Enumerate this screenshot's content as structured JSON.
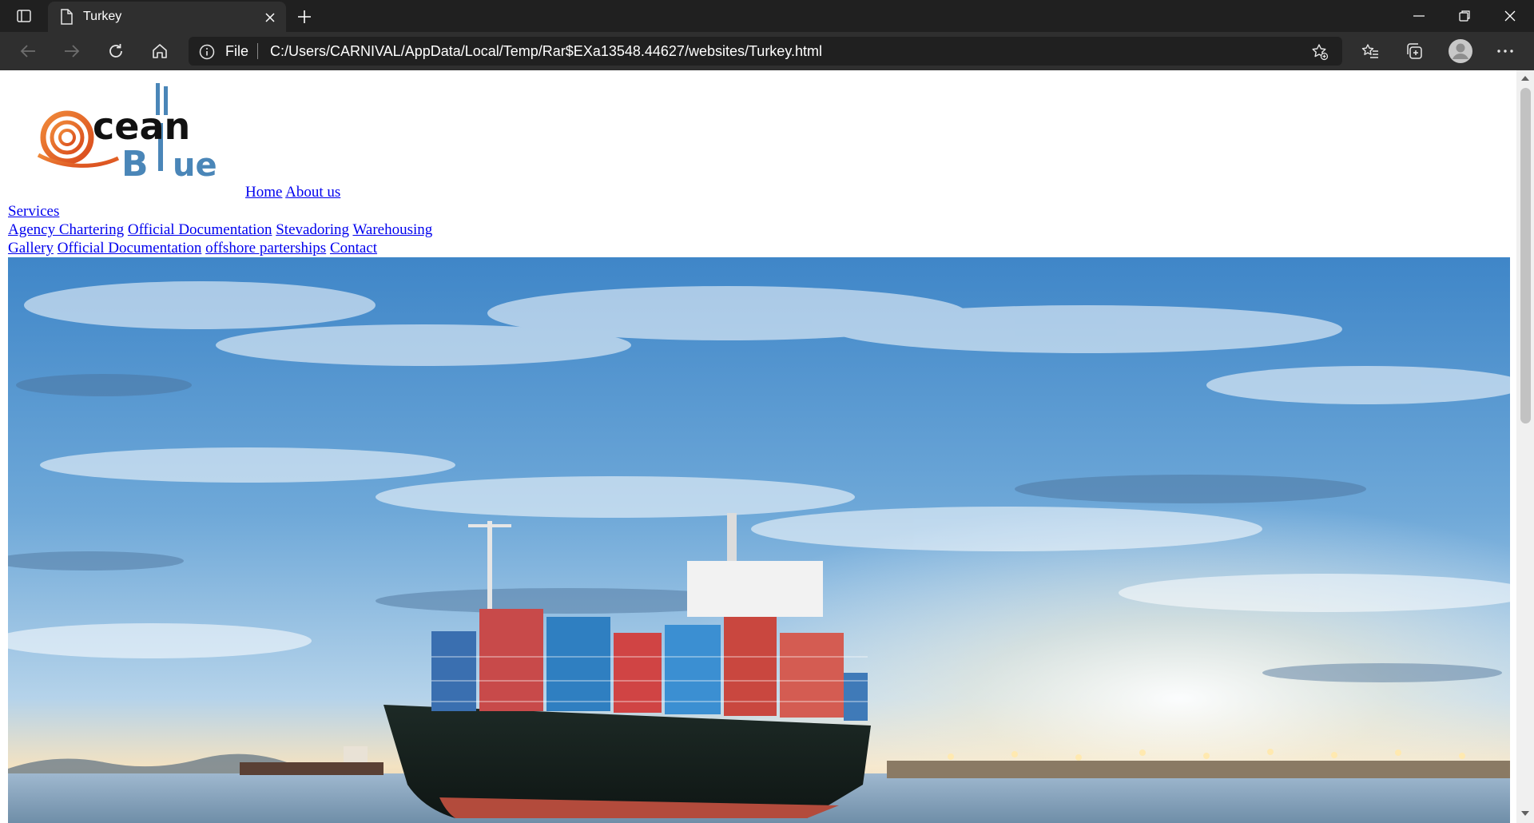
{
  "browser": {
    "tab": {
      "title": "Turkey"
    },
    "address": {
      "scheme_label": "File",
      "url": "C:/Users/CARNIVAL/AppData/Local/Temp/Rar$EXa13548.44627/websites/Turkey.html"
    },
    "icons": {
      "tab_actions": "tab-actions-icon",
      "page": "document-icon",
      "close": "close-icon",
      "new_tab": "plus-icon",
      "back": "arrow-left-icon",
      "forward": "arrow-right-icon",
      "refresh": "refresh-icon",
      "home": "home-icon",
      "info": "info-icon",
      "favorite_add": "star-plus-icon",
      "favorites": "favorites-list-icon",
      "collections": "collections-icon",
      "profile": "profile-icon",
      "more": "more-icon",
      "minimize": "minimize-icon",
      "restore": "restore-icon",
      "window_close": "window-close-icon"
    },
    "colors": {
      "tabbar": "#202020",
      "toolbar": "#2f2f2f",
      "link": "#0000ee"
    }
  },
  "site": {
    "logo": {
      "line1": "cean",
      "line2": "B",
      "line3": "ue"
    },
    "nav_row1": [
      {
        "label": "Home"
      },
      {
        "label": "About us"
      }
    ],
    "nav_row2": [
      {
        "label": "Services"
      }
    ],
    "nav_row3": [
      {
        "label": "Agency Chartering"
      },
      {
        "label": "Official Documentation"
      },
      {
        "label": "Stevadoring"
      },
      {
        "label": "Warehousing"
      }
    ],
    "nav_row4": [
      {
        "label": "Gallery"
      },
      {
        "label": "Official Documentation"
      },
      {
        "label": "offshore parterships"
      },
      {
        "label": "Contact"
      }
    ],
    "hero_image": "container-ship-harbor-photo"
  }
}
